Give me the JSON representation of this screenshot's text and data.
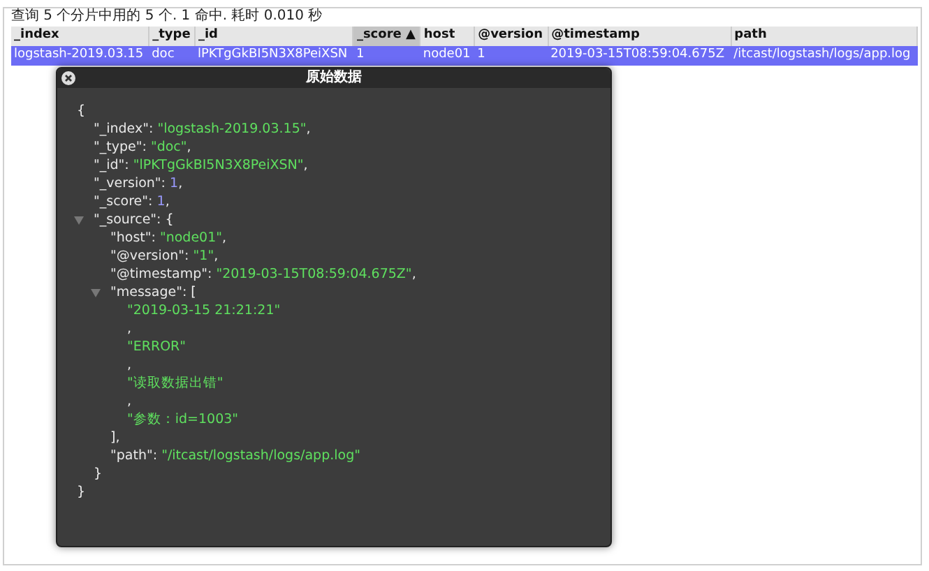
{
  "status_text": "查询 5 个分片中用的 5 个. 1 命中. 耗时 0.010 秒",
  "table": {
    "columns": [
      {
        "label": "_index",
        "sorted": false
      },
      {
        "label": "_type",
        "sorted": false
      },
      {
        "label": "_id",
        "sorted": false
      },
      {
        "label": "_score",
        "sorted": true,
        "sort_arrow": "▲"
      },
      {
        "label": "host",
        "sorted": false
      },
      {
        "label": "@version",
        "sorted": false
      },
      {
        "label": "@timestamp",
        "sorted": false
      },
      {
        "label": "path",
        "sorted": false
      }
    ],
    "rows": [
      {
        "selected": true,
        "cells": [
          "logstash-2019.03.15",
          "doc",
          "lPKTgGkBI5N3X8PeiXSN",
          "1",
          "node01",
          "1",
          "2019-03-15T08:59:04.675Z",
          "/itcast/logstash/logs/app.log"
        ]
      }
    ]
  },
  "dialog": {
    "title": "原始数据",
    "document": {
      "kind": "root",
      "open": "{",
      "close": "}",
      "children": [
        {
          "kind": "string",
          "key": "\"_index\"",
          "sep": ": ",
          "value": "\"logstash-2019.03.15\"",
          "trail": ","
        },
        {
          "kind": "string",
          "key": "\"_type\"",
          "sep": ": ",
          "value": "\"doc\"",
          "trail": ","
        },
        {
          "kind": "string",
          "key": "\"_id\"",
          "sep": ": ",
          "value": "\"lPKTgGkBI5N3X8PeiXSN\"",
          "trail": ","
        },
        {
          "kind": "number",
          "key": "\"_version\"",
          "sep": ": ",
          "value": "1",
          "trail": ","
        },
        {
          "kind": "number",
          "key": "\"_score\"",
          "sep": ": ",
          "value": "1",
          "trail": ","
        },
        {
          "kind": "object",
          "key": "\"_source\"",
          "sep": ": ",
          "open": "{",
          "close": "}",
          "expanded": true,
          "children": [
            {
              "kind": "string",
              "key": "\"host\"",
              "sep": ": ",
              "value": "\"node01\"",
              "trail": ","
            },
            {
              "kind": "string",
              "key": "\"@version\"",
              "sep": ": ",
              "value": "\"1\"",
              "trail": ","
            },
            {
              "kind": "string",
              "key": "\"@timestamp\"",
              "sep": ": ",
              "value": "\"2019-03-15T08:59:04.675Z\"",
              "trail": ","
            },
            {
              "kind": "object",
              "key": "\"message\"",
              "sep": ": ",
              "open": "[",
              "close": "]",
              "close_trail": ",",
              "expanded": true,
              "children": [
                {
                  "kind": "string_item",
                  "value": "\"2019-03-15 21:21:21\""
                },
                {
                  "kind": "punct",
                  "text": ","
                },
                {
                  "kind": "string_item",
                  "value": "\"ERROR\""
                },
                {
                  "kind": "punct",
                  "text": ","
                },
                {
                  "kind": "string_item",
                  "value": "\"读取数据出错\""
                },
                {
                  "kind": "punct",
                  "text": ","
                },
                {
                  "kind": "string_item",
                  "value": "\"参数：id=1003\""
                }
              ]
            },
            {
              "kind": "string",
              "key": "\"path\"",
              "sep": ": ",
              "value": "\"/itcast/logstash/logs/app.log\""
            }
          ]
        }
      ]
    }
  }
}
